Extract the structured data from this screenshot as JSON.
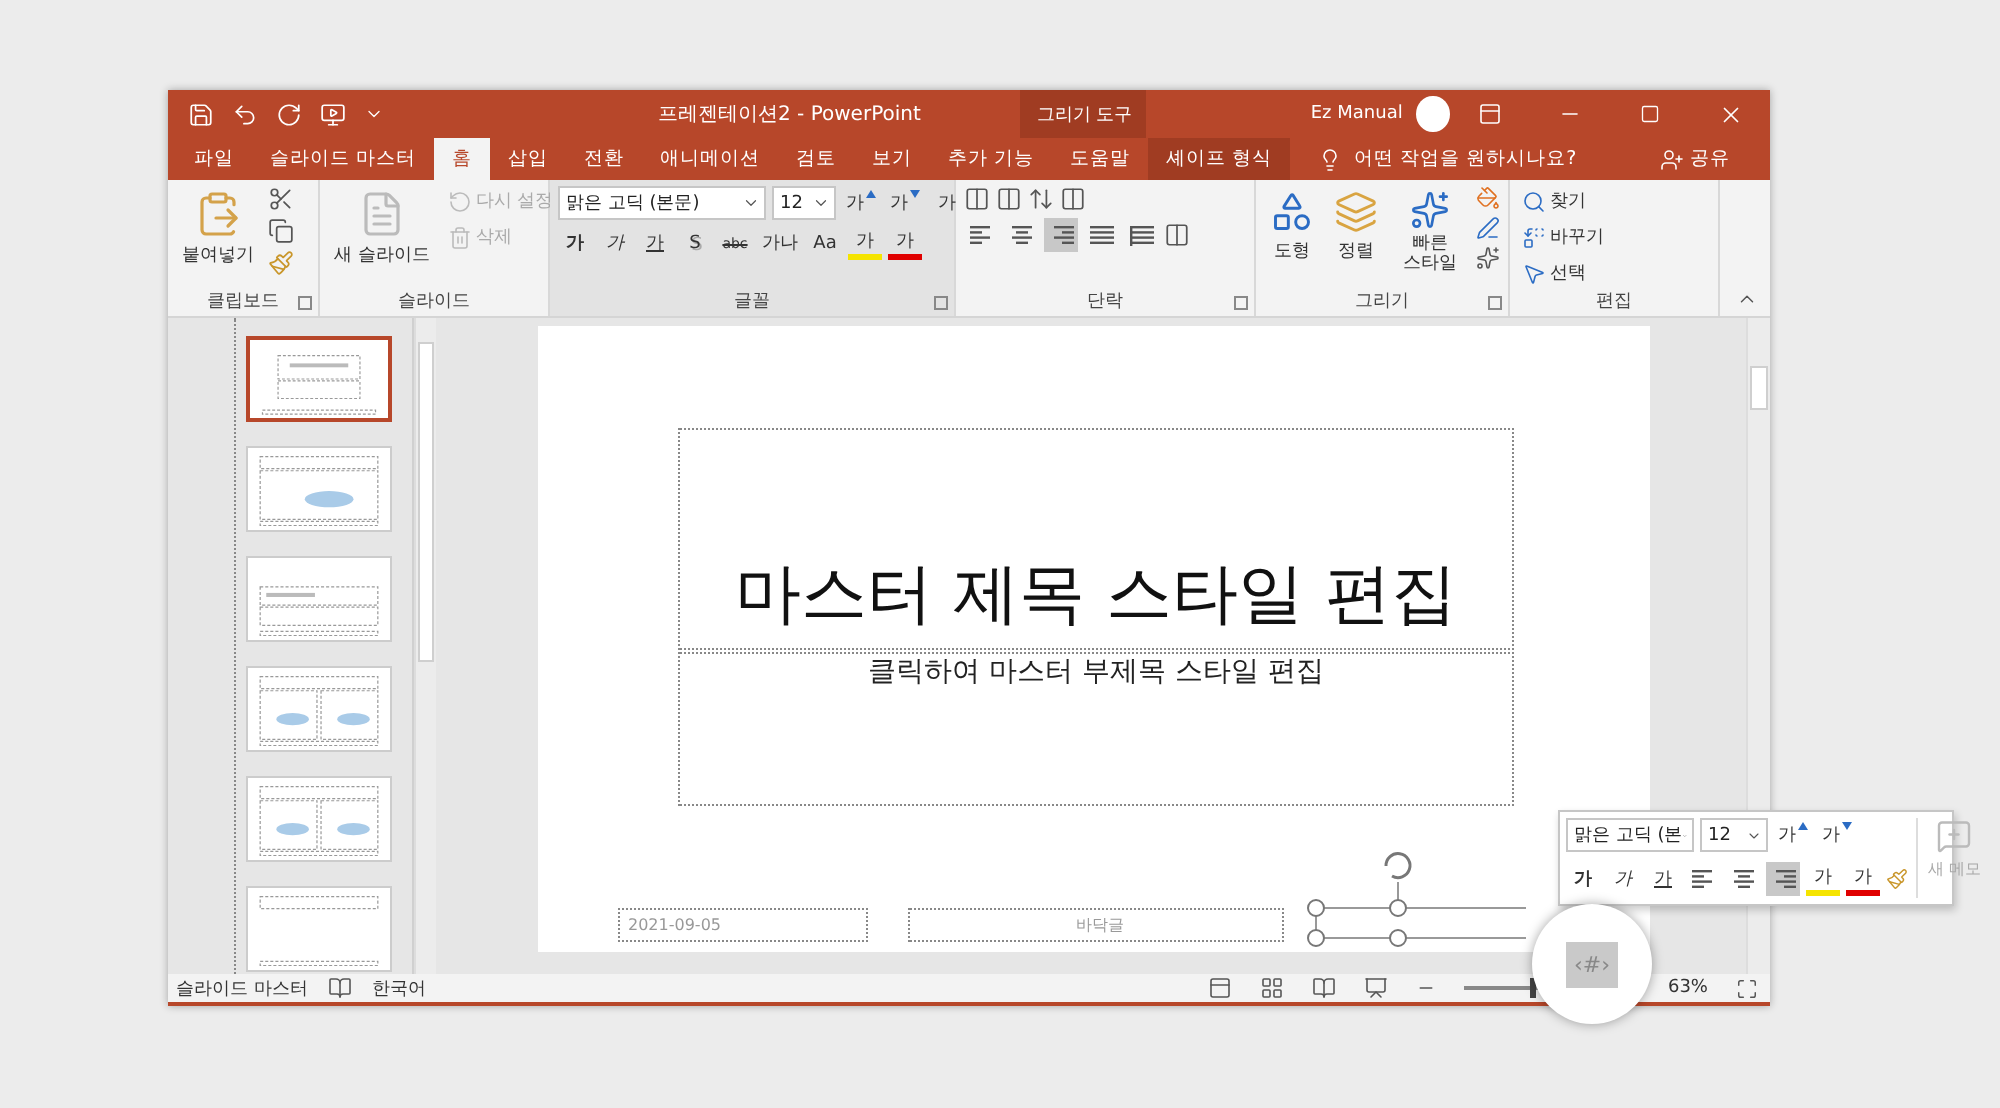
{
  "window": {
    "title": "프레젠테이션2  -  PowerPoint",
    "context_group": "그리기 도구",
    "account": "Ez Manual"
  },
  "tabs": [
    {
      "label": "파일",
      "selected": false,
      "contextual": false
    },
    {
      "label": "슬라이드 마스터",
      "selected": false,
      "contextual": false
    },
    {
      "label": "홈",
      "selected": true,
      "contextual": false
    },
    {
      "label": "삽입",
      "selected": false,
      "contextual": false
    },
    {
      "label": "전환",
      "selected": false,
      "contextual": false
    },
    {
      "label": "애니메이션",
      "selected": false,
      "contextual": false
    },
    {
      "label": "검토",
      "selected": false,
      "contextual": false
    },
    {
      "label": "보기",
      "selected": false,
      "contextual": false
    },
    {
      "label": "추가 기능",
      "selected": false,
      "contextual": false
    },
    {
      "label": "도움말",
      "selected": false,
      "contextual": false
    },
    {
      "label": "셰이프 형식",
      "selected": false,
      "contextual": true
    }
  ],
  "tell_me": "어떤 작업을 원하시나요?",
  "share": "공유",
  "ribbon": {
    "clipboard": {
      "label": "클립보드",
      "paste": "붙여넣기"
    },
    "slides": {
      "label": "슬라이드",
      "new_slide": "새 슬라이드",
      "items": [
        {
          "label": "다시 설정",
          "disabled": true
        },
        {
          "label": "삭제",
          "disabled": true
        }
      ]
    },
    "font": {
      "label": "글꼴",
      "font_name": "맑은 고딕 (본문)",
      "font_size": "12",
      "size_buttons": [
        {
          "label": "가",
          "kind": "grow"
        },
        {
          "label": "가",
          "kind": "shrink"
        },
        {
          "label": "가",
          "kind": "clear"
        }
      ],
      "format_buttons": [
        {
          "label": "가",
          "kind": "bold"
        },
        {
          "label": "가",
          "kind": "italic"
        },
        {
          "label": "가",
          "kind": "underline"
        },
        {
          "label": "S",
          "kind": "shadow"
        },
        {
          "label": "abc",
          "kind": "strike"
        },
        {
          "label": "가나",
          "kind": "spacing"
        },
        {
          "label": "Aa",
          "kind": "case"
        },
        {
          "label": "가",
          "kind": "highlight"
        },
        {
          "label": "가",
          "kind": "color"
        }
      ]
    },
    "paragraph": {
      "label": "단락",
      "align": [
        {
          "selected": false
        },
        {
          "selected": false
        },
        {
          "selected": true
        },
        {
          "selected": false
        },
        {
          "selected": false
        }
      ]
    },
    "drawing": {
      "label": "그리기",
      "shapes": "도형",
      "arrange": "정렬",
      "quick_styles": "빠른 스타일"
    },
    "editing": {
      "label": "편집",
      "items": [
        {
          "label": "찾기",
          "kind": "find"
        },
        {
          "label": "바꾸기",
          "kind": "replace"
        },
        {
          "label": "선택",
          "kind": "select"
        }
      ]
    }
  },
  "thumbnails": [
    {
      "selected": true,
      "kind": "title"
    },
    {
      "selected": false,
      "kind": "content"
    },
    {
      "selected": false,
      "kind": "section"
    },
    {
      "selected": false,
      "kind": "two"
    },
    {
      "selected": false,
      "kind": "two"
    },
    {
      "selected": false,
      "kind": "titleonly"
    }
  ],
  "slide": {
    "title": "마스터 제목 스타일 편집",
    "subtitle": "클릭하여 마스터 부제목 스타일 편집",
    "date": "2021-09-05",
    "footer": "바닥글"
  },
  "mini_toolbar": {
    "font_name": "맑은 고딕 (본",
    "font_size": "12",
    "size_buttons": [
      {
        "label": "가",
        "kind": "grow"
      },
      {
        "label": "가",
        "kind": "shrink"
      }
    ],
    "format_buttons": [
      {
        "label": "가",
        "kind": "bold"
      },
      {
        "label": "가",
        "kind": "italic"
      },
      {
        "label": "가",
        "kind": "underline"
      }
    ],
    "align": [
      {
        "selected": false
      },
      {
        "selected": false
      },
      {
        "selected": true
      }
    ],
    "color_buttons": [
      {
        "label": "가",
        "kind": "highlight"
      },
      {
        "label": "가",
        "kind": "color"
      }
    ],
    "comment": {
      "label": "새 메모",
      "disabled": true
    }
  },
  "magnifier": {
    "text": "‹#›"
  },
  "status_bar": {
    "view": "슬라이드 마스터",
    "language": "한국어",
    "zoom": "63%",
    "zoom_slider": {
      "level": 0.85
    }
  }
}
